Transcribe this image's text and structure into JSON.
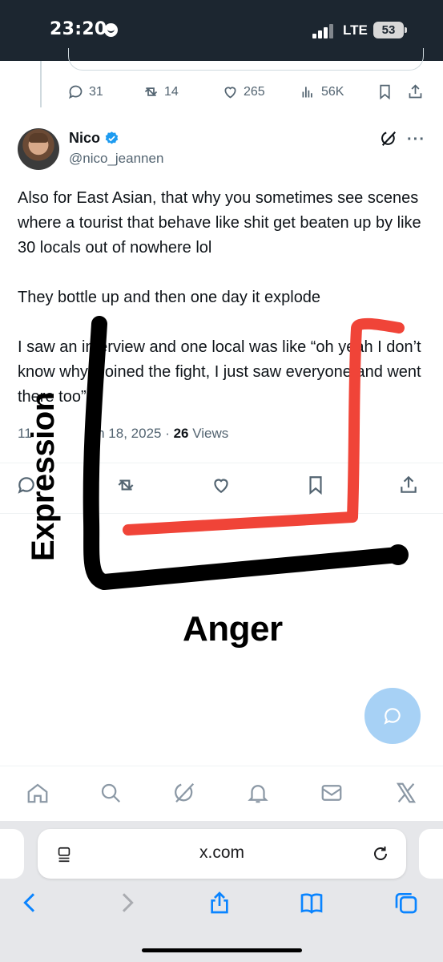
{
  "status_bar": {
    "time": "23:20",
    "network": "LTE",
    "battery": "53"
  },
  "previous_tweet": {
    "replies": "31",
    "reposts": "14",
    "likes": "265",
    "views": "56K"
  },
  "tweet": {
    "display_name": "Nico",
    "handle": "@nico_jeannen",
    "paragraphs": [
      "Also for East Asian, that why you sometimes see scenes where a tourist that behave like shit get beaten up by like 30 locals out of nowhere lol",
      "They bottle up and then one day it explode",
      "I saw an interview and one local was like “oh yeah I don’t know why I joined the fight, I just saw everyone and went there too”"
    ],
    "time_prefix": "11",
    "date_suffix": "n 18, 2025",
    "meta_separator": " · ",
    "views_count": "26",
    "views_label": " Views"
  },
  "drawing": {
    "vertical_label": "Expression",
    "horizontal_label": "Anger",
    "axis_color": "#000000",
    "curve_color": "#f04438"
  },
  "browser": {
    "url": "x.com"
  },
  "colors": {
    "accent": "#1d9bf0",
    "muted": "#536471",
    "fab": "#a7d1f5"
  },
  "icons": {
    "bottom_nav": [
      "home-icon",
      "search-icon",
      "grok-icon",
      "notifications-icon",
      "messages-icon",
      "x-logo-icon"
    ],
    "safari_toolbar": [
      "back-icon",
      "forward-icon",
      "share-icon",
      "bookmarks-icon",
      "tabs-icon"
    ]
  }
}
